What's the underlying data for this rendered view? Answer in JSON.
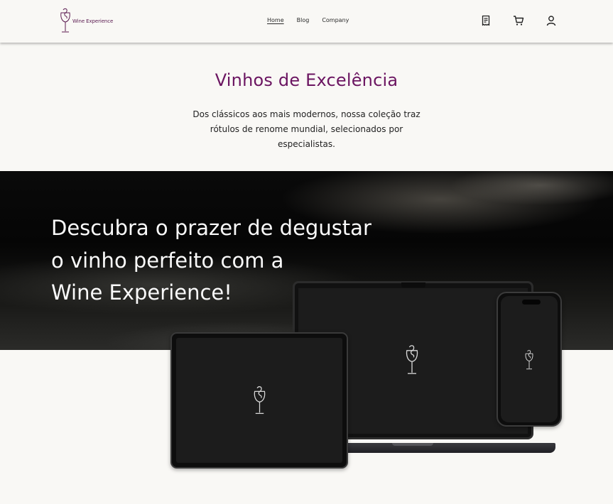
{
  "brand": {
    "name": "Wine Experience"
  },
  "nav": {
    "links": [
      "Home",
      "Blog",
      "Company"
    ],
    "active": "Home"
  },
  "icons": [
    "receipt-icon",
    "cart-icon",
    "user-icon",
    "wine-glass-icon"
  ],
  "intro": {
    "title": "Vinhos de Excelência",
    "description": "Dos clássicos aos mais modernos, nossa coleção traz rótulos de renome mundial, selecionados por especialistas."
  },
  "hero": {
    "title_line1": "Descubra o prazer de degustar",
    "title_line2": "o vinho perfeito com a",
    "title_line3": "Wine Experience!"
  },
  "colors": {
    "accent": "#6b1561",
    "background": "#f9f8f5",
    "hero_text": "#fafafa"
  }
}
